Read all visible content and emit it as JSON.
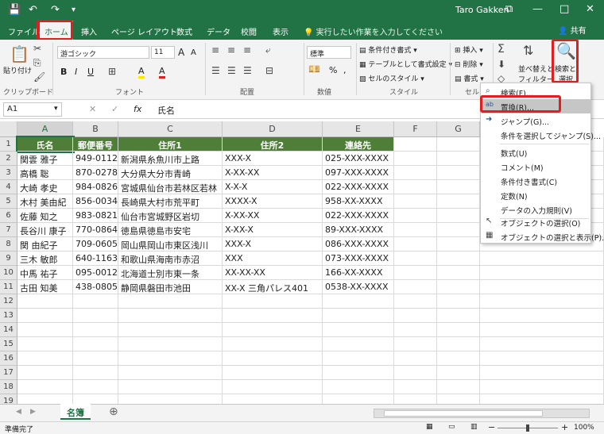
{
  "title": {
    "user": "Taro Gakken"
  },
  "quick_access": {
    "save_icon": "💾",
    "undo_icon": "↶",
    "redo_icon": "↷",
    "customize_icon": "▾"
  },
  "window": {
    "restore_icon": "⧉",
    "min_icon": "—",
    "max_icon": "□",
    "close_icon": "✕"
  },
  "menu": [
    "ファイル",
    "ホーム",
    "挿入",
    "ページ レイアウト",
    "数式",
    "データ",
    "校閲",
    "表示"
  ],
  "tell_me": "実行したい作業を入力してください",
  "share": "共有",
  "ribbon": {
    "clipboard": {
      "paste": "貼り付け",
      "group": "クリップボード"
    },
    "font": {
      "name": "游ゴシック",
      "size": "11",
      "grow": "A",
      "shrink": "A",
      "bold": "B",
      "italic": "I",
      "underline": "U",
      "fill_color": "A",
      "font_color": "A",
      "group": "フォント"
    },
    "alignment": {
      "group": "配置"
    },
    "number": {
      "format": "標準",
      "percent": "%",
      "comma": ",",
      "group": "数値"
    },
    "styles": {
      "conditional": "条件付き書式",
      "table": "テーブルとして書式設定",
      "cell_styles": "セルのスタイル",
      "group": "スタイル"
    },
    "cells": {
      "insert": "挿入",
      "delete": "削除",
      "format": "書式",
      "group": "セル"
    },
    "editing": {
      "sort_filter": "並べ替えと",
      "sort_filter2": "フィルター",
      "find_select": "検索と",
      "find_select2": "選択"
    }
  },
  "formula_bar": {
    "name_box": "A1",
    "cancel": "✕",
    "enter": "✓",
    "fx": "fx",
    "value": "氏名"
  },
  "columns": [
    "A",
    "B",
    "C",
    "D",
    "E",
    "F",
    "G"
  ],
  "rows": [
    "1",
    "2",
    "3",
    "4",
    "5",
    "6",
    "7",
    "8",
    "9",
    "10",
    "11",
    "12",
    "13",
    "14",
    "15",
    "16",
    "17",
    "18",
    "19"
  ],
  "table": {
    "headers": [
      "氏名",
      "郵便番号",
      "住所1",
      "住所2",
      "連絡先"
    ],
    "data": [
      [
        "関雲 雅子",
        "949-0112",
        "新潟県糸魚川市上路",
        "XXX-X",
        "025-XXX-XXXX"
      ],
      [
        "高橋 聡",
        "870-0278",
        "大分県大分市青崎",
        "X-XX-XX",
        "097-XXX-XXXX"
      ],
      [
        "大崎 孝史",
        "984-0826",
        "宮城県仙台市若林区若林",
        "X-X-X",
        "022-XXX-XXXX"
      ],
      [
        "木村 美由紀",
        "856-0034",
        "長崎県大村市荒平町",
        "XXXX-X",
        "958-XX-XXXX"
      ],
      [
        "佐藤 知之",
        "983-0821",
        "仙台市宮城野区岩切",
        "X-XX-XX",
        "022-XXX-XXXX"
      ],
      [
        "長谷川 康子",
        "770-0864",
        "徳島県徳島市安宅",
        "X-XX-X",
        "89-XXX-XXXX"
      ],
      [
        "関 由紀子",
        "709-0605",
        "岡山県岡山市東区浅川",
        "XXX-X",
        "086-XXX-XXXX"
      ],
      [
        "三木 敏郎",
        "640-1163",
        "和歌山県海南市赤沼",
        "XXX",
        "073-XXX-XXXX"
      ],
      [
        "中馬 祐子",
        "095-0012",
        "北海道士別市東一条",
        "XX-XX-XX",
        "166-XX-XXXX"
      ],
      [
        "古田 知美",
        "438-0805",
        "静岡県磐田市池田",
        "XX-X 三角パレス401",
        "0538-XX-XXXX"
      ]
    ]
  },
  "dropdown": [
    {
      "label": "検索(F)...",
      "icon": "⌕"
    },
    {
      "label": "置換(R)...",
      "icon": "ab"
    },
    {
      "label": "ジャンプ(G)...",
      "icon": "➜"
    },
    {
      "label": "条件を選択してジャンプ(S)...",
      "icon": ""
    },
    {
      "label": "数式(U)",
      "icon": ""
    },
    {
      "label": "コメント(M)",
      "icon": ""
    },
    {
      "label": "条件付き書式(C)",
      "icon": ""
    },
    {
      "label": "定数(N)",
      "icon": ""
    },
    {
      "label": "データの入力規則(V)",
      "icon": ""
    },
    {
      "label": "オブジェクトの選択(O)",
      "icon": "↖"
    },
    {
      "label": "オブジェクトの選択と表示(P)...",
      "icon": "▦"
    }
  ],
  "sheet_tab": "名簿",
  "add_sheet": "⊕",
  "status": {
    "ready": "準備完了",
    "zoom": "100%",
    "minus": "−",
    "plus": "+"
  },
  "colors": {
    "excel_green": "#217346",
    "header_fill": "#4f7e39",
    "highlight_red": "#e02020"
  }
}
